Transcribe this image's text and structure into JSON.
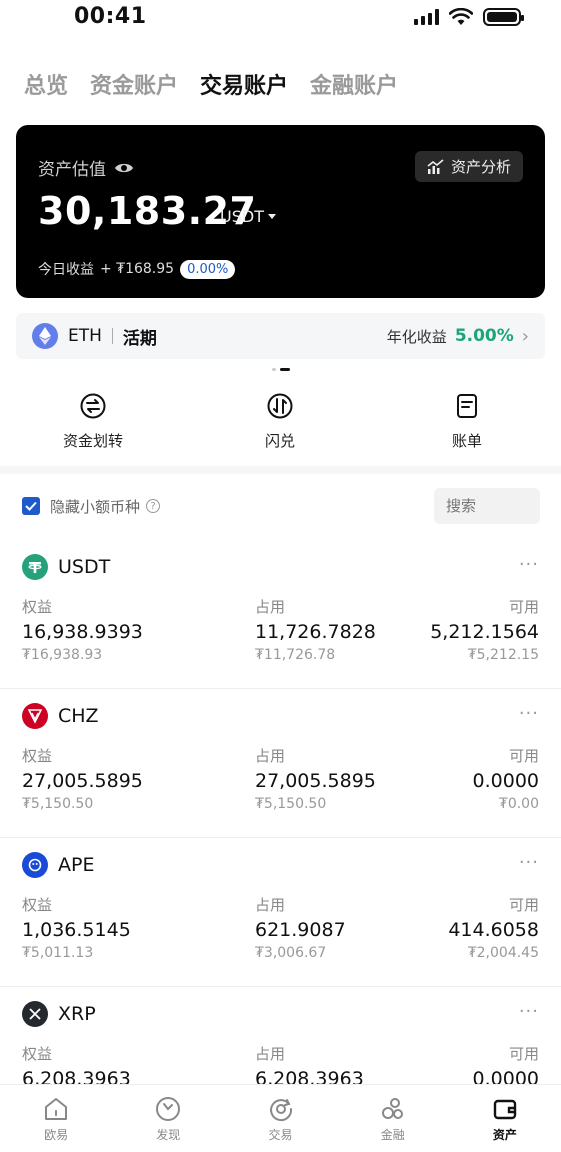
{
  "status": {
    "time": "00:41"
  },
  "tabs": [
    {
      "label": "总览"
    },
    {
      "label": "资金账户"
    },
    {
      "label": "交易账户"
    },
    {
      "label": "金融账户"
    }
  ],
  "asset_card": {
    "label": "资产估值",
    "analysis_button": "资产分析",
    "value": "30,183.27",
    "unit": "USDT",
    "today_label": "今日收益",
    "today_value": "+ ₮168.95",
    "today_percent": "0.00%"
  },
  "earn_banner": {
    "coin": "ETH",
    "type": "活期",
    "rate_label": "年化收益",
    "rate": "5.00%"
  },
  "actions": [
    {
      "label": "资金划转",
      "icon": "transfer-icon"
    },
    {
      "label": "闪兑",
      "icon": "swap-icon"
    },
    {
      "label": "账单",
      "icon": "bill-icon"
    }
  ],
  "filter": {
    "hide_small_label": "隐藏小额币种",
    "search_placeholder": "搜索"
  },
  "column_headers": {
    "equity": "权益",
    "used": "占用",
    "available": "可用"
  },
  "coins": [
    {
      "name": "USDT",
      "color": "#26a17b",
      "glyph": "T",
      "equity": "16,938.9393",
      "equity_fiat": "₮16,938.93",
      "used": "11,726.7828",
      "used_fiat": "₮11,726.78",
      "available": "5,212.1564",
      "available_fiat": "₮5,212.15"
    },
    {
      "name": "CHZ",
      "color": "#cd0124",
      "glyph": "C",
      "equity": "27,005.5895",
      "equity_fiat": "₮5,150.50",
      "used": "27,005.5895",
      "used_fiat": "₮5,150.50",
      "available": "0.0000",
      "available_fiat": "₮0.00"
    },
    {
      "name": "APE",
      "color": "#1a4bd6",
      "glyph": "A",
      "equity": "1,036.5145",
      "equity_fiat": "₮5,011.13",
      "used": "621.9087",
      "used_fiat": "₮3,006.67",
      "available": "414.6058",
      "available_fiat": "₮2,004.45"
    },
    {
      "name": "XRP",
      "color": "#23292f",
      "glyph": "X",
      "equity": "6,208.3963",
      "equity_fiat": "",
      "used": "6,208.3963",
      "used_fiat": "",
      "available": "0.0000",
      "available_fiat": ""
    }
  ],
  "bottom_nav": [
    {
      "label": "欧易",
      "icon": "home-icon"
    },
    {
      "label": "发现",
      "icon": "discover-icon"
    },
    {
      "label": "交易",
      "icon": "trade-icon"
    },
    {
      "label": "金融",
      "icon": "finance-icon"
    },
    {
      "label": "资产",
      "icon": "wallet-icon"
    }
  ]
}
